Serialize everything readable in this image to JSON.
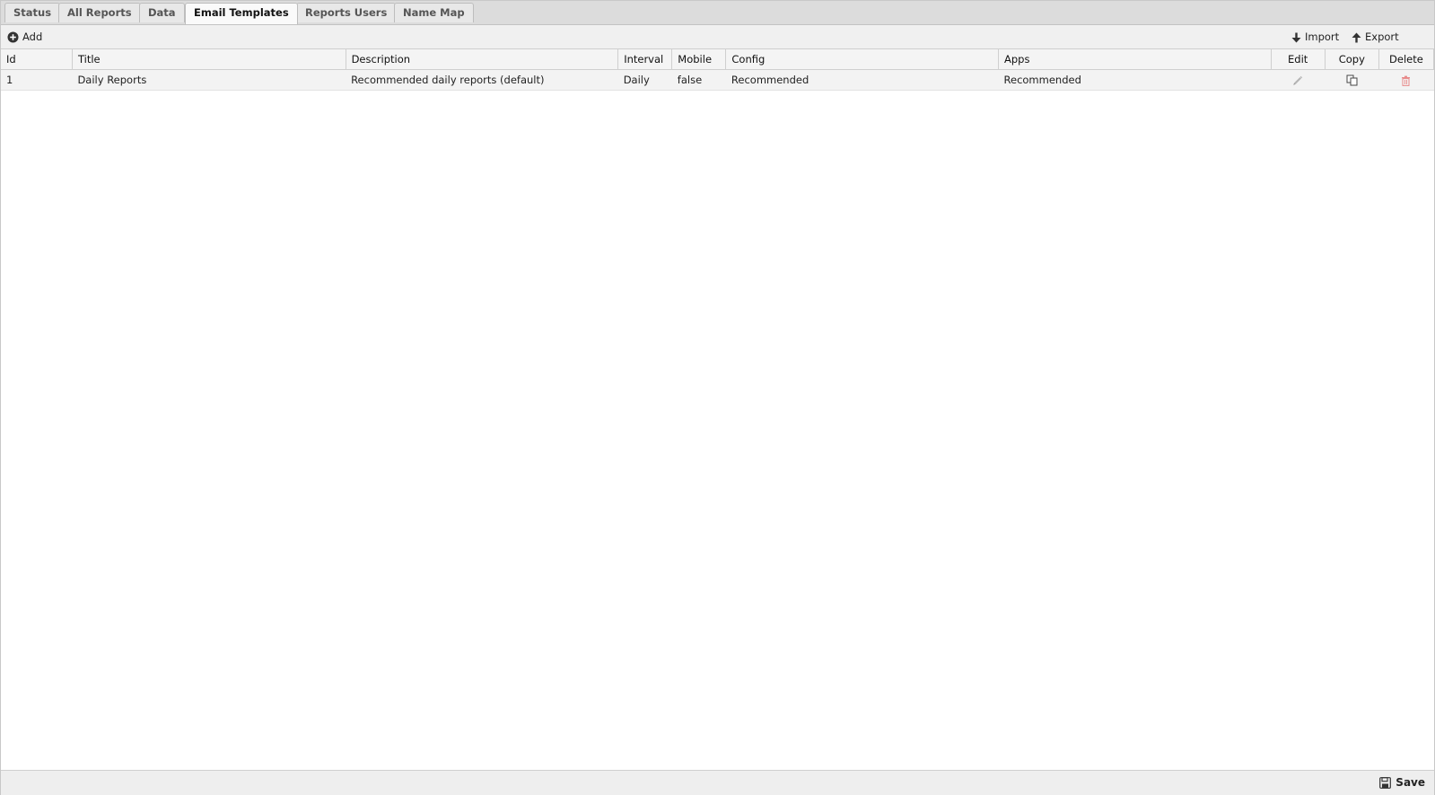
{
  "tabs": [
    {
      "label": "Status"
    },
    {
      "label": "All Reports"
    },
    {
      "label": "Data"
    },
    {
      "label": "Email Templates",
      "active": true
    },
    {
      "label": "Reports Users"
    },
    {
      "label": "Name Map"
    }
  ],
  "toolbar": {
    "add_label": "Add",
    "import_label": "Import",
    "export_label": "Export"
  },
  "table": {
    "columns": [
      "Id",
      "Title",
      "Description",
      "Interval",
      "Mobile",
      "Config",
      "Apps",
      "Edit",
      "Copy",
      "Delete"
    ],
    "rows": [
      {
        "id": "1",
        "title": "Daily Reports",
        "description": "Recommended daily reports (default)",
        "interval": "Daily",
        "mobile": "false",
        "config": "Recommended",
        "apps": "Recommended"
      }
    ]
  },
  "icons": {
    "add": "plus-circle-icon",
    "import": "arrow-down-icon",
    "export": "arrow-up-icon",
    "edit": "pencil-icon",
    "copy": "copy-icon",
    "delete": "trash-icon",
    "save": "floppy-disk-icon"
  },
  "colors": {
    "delete_icon": "#e88a8a",
    "header_bg": "#f4f4f4",
    "tabbar_bg": "#dcdcdc"
  },
  "footer": {
    "save_label": "Save"
  }
}
